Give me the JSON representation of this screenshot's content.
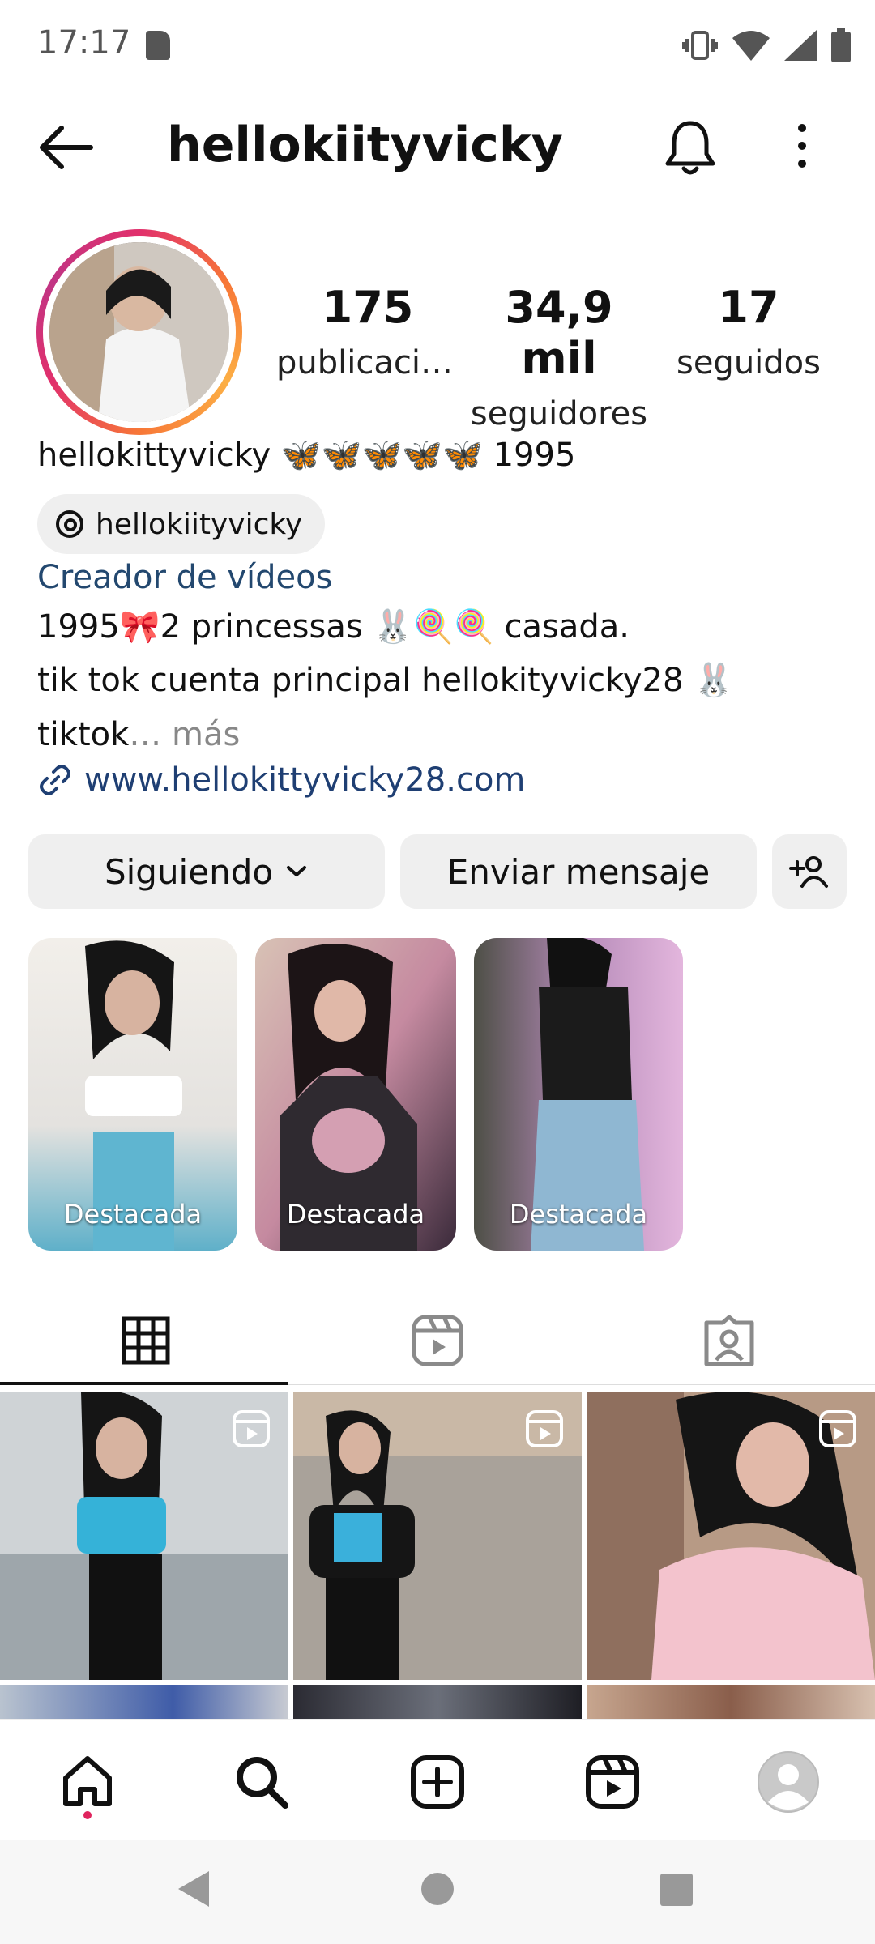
{
  "status_bar": {
    "time": "17:17"
  },
  "header": {
    "username": "hellokiityvicky"
  },
  "profile": {
    "stats": [
      {
        "value": "175",
        "label": "publicaciones"
      },
      {
        "value": "34,9 mil",
        "label": "seguidores"
      },
      {
        "value": "17",
        "label": "seguidos"
      }
    ],
    "name_line": "hellokittyvicky 🦋🦋🦋🦋🦋 1995",
    "threads_handle": "hellokiityvicky",
    "category": "Creador de vídeos",
    "bio_lines": [
      "1995🎀2 princessas 🐰🍭🍭 casada.",
      "tik tok cuenta principal  hellokityvicky28 🐰",
      "tiktok"
    ],
    "bio_more_label": "… más",
    "website": "www.hellokittyvicky28.com"
  },
  "actions": {
    "following_label": "Siguiendo",
    "message_label": "Enviar mensaje"
  },
  "highlights": [
    {
      "label": "Destacada"
    },
    {
      "label": "Destacada"
    },
    {
      "label": "Destacada"
    }
  ],
  "tabs": [
    "posts-grid",
    "reels",
    "tagged"
  ],
  "colors": {
    "link": "#1f3f73",
    "category": "#23486f",
    "accent_ring": "#e1306c",
    "notification_dot": "#e0245e"
  }
}
